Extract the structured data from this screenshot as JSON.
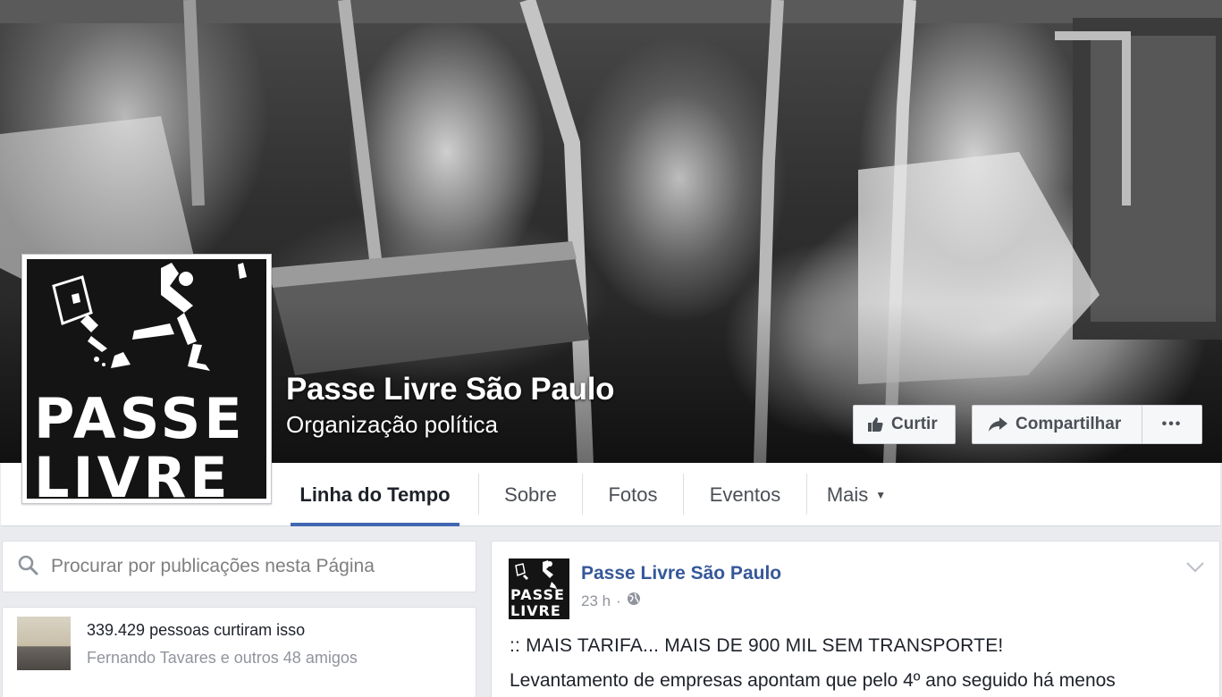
{
  "page": {
    "name": "Passe Livre São Paulo",
    "category": "Organização política"
  },
  "cover_actions": {
    "like_label": "Curtir",
    "share_label": "Compartilhar",
    "more_label": "•••"
  },
  "tabs": [
    {
      "label": "Linha do Tempo",
      "active": true
    },
    {
      "label": "Sobre"
    },
    {
      "label": "Fotos"
    },
    {
      "label": "Eventos"
    },
    {
      "label": "Mais"
    }
  ],
  "logo": {
    "line1": "PASSE",
    "line2": "LIVRE"
  },
  "search": {
    "placeholder": "Procurar por publicações nesta Página"
  },
  "likes": {
    "count_text": "339.429 pessoas curtiram isso",
    "friends_text": "Fernando Tavares e outros 48 amigos"
  },
  "post": {
    "author": "Passe Livre São Paulo",
    "time": "23 h",
    "separator": "·",
    "line1": ":: MAIS TARIFA... MAIS DE 900 MIL SEM TRANSPORTE!",
    "line2": "Levantamento de empresas apontam que pelo 4º ano seguido há menos"
  },
  "colors": {
    "accent": "#4267b2",
    "link": "#365899",
    "muted": "#90949c",
    "background": "#e9ebee"
  }
}
